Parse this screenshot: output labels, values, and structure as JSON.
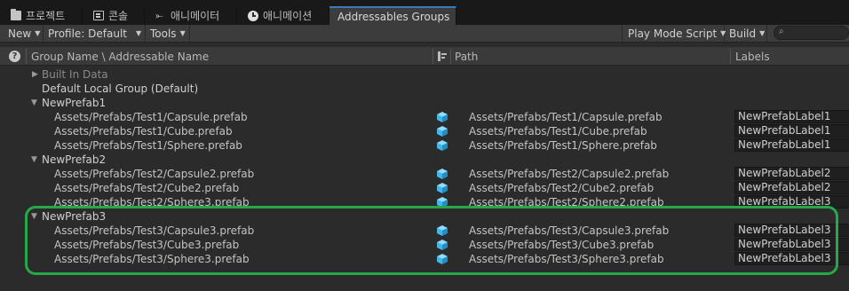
{
  "tabs": [
    {
      "label": "프로젝트",
      "icon": "folder-icon"
    },
    {
      "label": "콘솔",
      "icon": "console-icon"
    },
    {
      "label": "애니메이터",
      "icon": "animator-icon"
    },
    {
      "label": "애니메이션",
      "icon": "animation-clock-icon"
    },
    {
      "label": "Addressables Groups",
      "icon": ""
    }
  ],
  "toolbar": {
    "new_label": "New",
    "profile_label": "Profile: Default",
    "tools_label": "Tools",
    "play_mode_label": "Play Mode Script",
    "build_label": "Build",
    "search_placeholder": ""
  },
  "columns": {
    "group_name": "Group Name \\ Addressable Name",
    "path": "Path",
    "labels": "Labels"
  },
  "groups": [
    {
      "name": "Built In Data",
      "expanded": false,
      "dim": true,
      "entries": []
    },
    {
      "name": "Default Local Group (Default)",
      "expanded": null,
      "dim": false,
      "entries": []
    },
    {
      "name": "NewPrefab1",
      "expanded": true,
      "dim": false,
      "entries": [
        {
          "name": "Assets/Prefabs/Test1/Capsule.prefab",
          "path": "Assets/Prefabs/Test1/Capsule.prefab",
          "label": "NewPrefabLabel1"
        },
        {
          "name": "Assets/Prefabs/Test1/Cube.prefab",
          "path": "Assets/Prefabs/Test1/Cube.prefab",
          "label": "NewPrefabLabel1"
        },
        {
          "name": "Assets/Prefabs/Test1/Sphere.prefab",
          "path": "Assets/Prefabs/Test1/Sphere.prefab",
          "label": "NewPrefabLabel1"
        }
      ]
    },
    {
      "name": "NewPrefab2",
      "expanded": true,
      "dim": false,
      "entries": [
        {
          "name": "Assets/Prefabs/Test2/Capsule2.prefab",
          "path": "Assets/Prefabs/Test2/Capsule2.prefab",
          "label": "NewPrefabLabel2"
        },
        {
          "name": "Assets/Prefabs/Test2/Cube2.prefab",
          "path": "Assets/Prefabs/Test2/Cube2.prefab",
          "label": "NewPrefabLabel2"
        },
        {
          "name": "Assets/Prefabs/Test2/Sphere3.prefab",
          "path": "Assets/Prefabs/Test2/Sphere2.prefab",
          "label": "NewPrefabLabel3"
        }
      ]
    },
    {
      "name": "NewPrefab3",
      "expanded": true,
      "dim": false,
      "entries": [
        {
          "name": "Assets/Prefabs/Test3/Capsule3.prefab",
          "path": "Assets/Prefabs/Test3/Capsule3.prefab",
          "label": "NewPrefabLabel3"
        },
        {
          "name": "Assets/Prefabs/Test3/Cube3.prefab",
          "path": "Assets/Prefabs/Test3/Cube3.prefab",
          "label": "NewPrefabLabel3"
        },
        {
          "name": "Assets/Prefabs/Test3/Sphere3.prefab",
          "path": "Assets/Prefabs/Test3/Sphere3.prefab",
          "label": "NewPrefabLabel3"
        }
      ]
    }
  ],
  "colors": {
    "highlight": "#27a84a",
    "cube": "#3fb7ea",
    "tab_accent": "#3a79bb"
  }
}
